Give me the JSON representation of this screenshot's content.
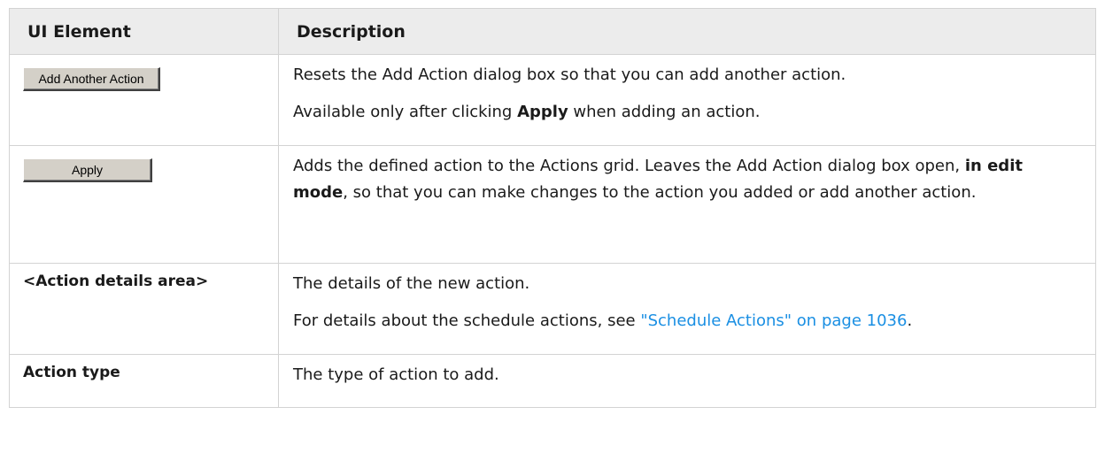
{
  "header": {
    "col_element": "UI Element",
    "col_description": "Description"
  },
  "rows": {
    "add_another": {
      "button_label": "Add Another Action",
      "desc1": "Resets the Add Action dialog box so that you can add another action.",
      "desc2_before": "Available only after clicking ",
      "desc2_bold": "Apply",
      "desc2_after": " when adding an action."
    },
    "apply": {
      "button_label": "Apply",
      "desc_before": "Adds the defined action to the Actions grid. Leaves the Add Action dialog box open, ",
      "desc_bold": "in edit mode",
      "desc_after": ", so that you can make changes to the action you added or add another action."
    },
    "details": {
      "term": "<Action details area>",
      "desc1": "The details of the new action.",
      "desc2_before": "For details about the schedule actions, see ",
      "desc2_link": "\"Schedule Actions\" on page 1036",
      "desc2_after": "."
    },
    "action_type": {
      "term": "Action type",
      "desc": "The type of action to add."
    }
  }
}
